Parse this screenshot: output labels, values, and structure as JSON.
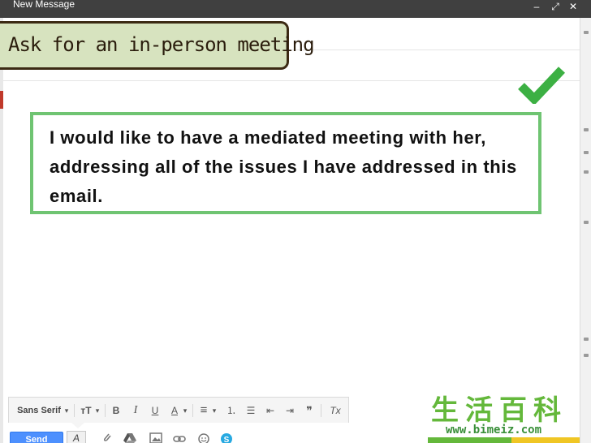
{
  "window": {
    "title": "New Message",
    "minimize_glyph": "–",
    "maximize_glyph": "⤢",
    "close_glyph": "✕"
  },
  "banner": {
    "text": "Ask for an in-person meeting"
  },
  "callout": {
    "text": "I would like to have a mediated meeting with her, addressing all of the issues I have addressed in this email."
  },
  "toolbar": {
    "font_label": "Sans Serif",
    "size_glyph": "тT",
    "bold_glyph": "B",
    "italic_glyph": "I",
    "underline_glyph": "U",
    "text_color_glyph": "A",
    "align_glyph": "≡",
    "numbered_list_glyph": "⒈",
    "bulleted_list_glyph": "☰",
    "indent_less_glyph": "⇤",
    "indent_more_glyph": "⇥",
    "quote_glyph": "❞",
    "remove_format_glyph": "Tx",
    "dropdown_glyph": "▾"
  },
  "bottom": {
    "send_label": "Send",
    "format_glyph": "A"
  },
  "watermark": {
    "chinese": "生活百科",
    "url": "www.bimeiz.com"
  },
  "colors": {
    "accent_green": "#6fc472",
    "check_green": "#3cb043",
    "banner_bg": "#d7e3bf",
    "send_blue": "#4d90fe",
    "titlebar": "#404040"
  },
  "icons": {
    "attach": "paperclip-icon",
    "drive": "drive-icon",
    "photo": "photo-icon",
    "link": "link-icon",
    "emoji": "emoji-icon",
    "skype": "skype-icon",
    "check": "checkmark-icon"
  }
}
